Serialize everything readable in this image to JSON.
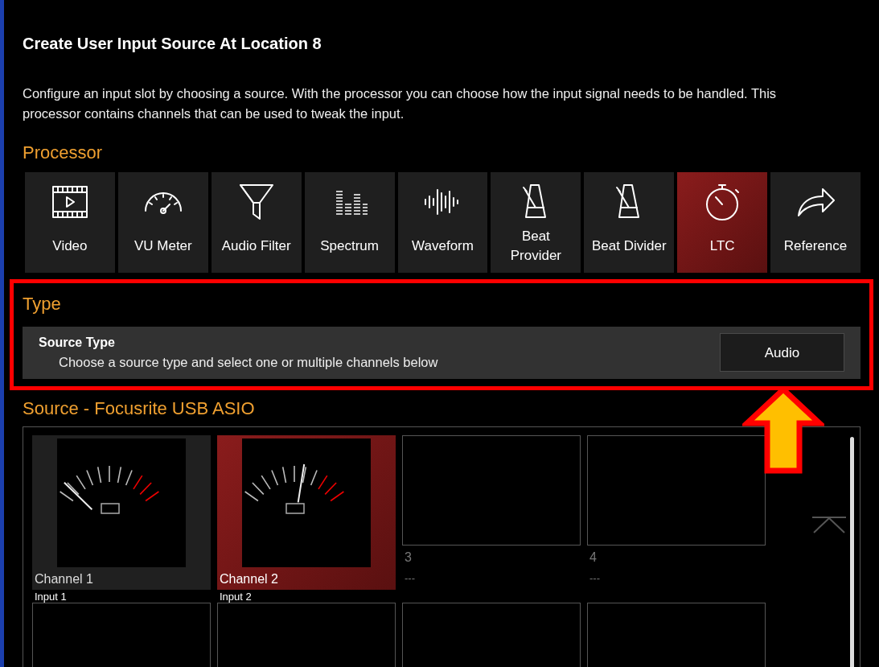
{
  "title": "Create User Input Source At Location 8",
  "description": "Configure an input slot by choosing a source. With the processor you can choose how the input signal needs to be handled. This processor contains channels that can be used to tweak the input.",
  "processor": {
    "heading": "Processor",
    "items": [
      {
        "label": "Video",
        "selected": false
      },
      {
        "label": "VU Meter",
        "selected": false
      },
      {
        "label": "Audio Filter",
        "selected": false
      },
      {
        "label": "Spectrum",
        "selected": false
      },
      {
        "label": "Waveform",
        "selected": false
      },
      {
        "label": "Beat Provider",
        "selected": false
      },
      {
        "label": "Beat Divider",
        "selected": false
      },
      {
        "label": "LTC",
        "selected": true
      },
      {
        "label": "Reference",
        "selected": false
      }
    ]
  },
  "type": {
    "heading": "Type",
    "setting": {
      "title": "Source Type",
      "hint": "Choose a source type and select one or multiple channels below",
      "button": "Audio"
    }
  },
  "source": {
    "heading": "Source - Focusrite USB ASIO",
    "slots": [
      {
        "kind": "meter",
        "name": "Channel 1",
        "detail": "Input 1",
        "selected": false
      },
      {
        "kind": "meter",
        "name": "Channel 2",
        "detail": "Input 2",
        "selected": true
      },
      {
        "kind": "empty",
        "name": "3",
        "detail": "---",
        "selected": false
      },
      {
        "kind": "empty",
        "name": "4",
        "detail": "---",
        "selected": false
      },
      {
        "kind": "empty",
        "selected": false
      },
      {
        "kind": "empty",
        "selected": false
      },
      {
        "kind": "empty",
        "selected": false
      },
      {
        "kind": "empty",
        "selected": false
      }
    ]
  }
}
